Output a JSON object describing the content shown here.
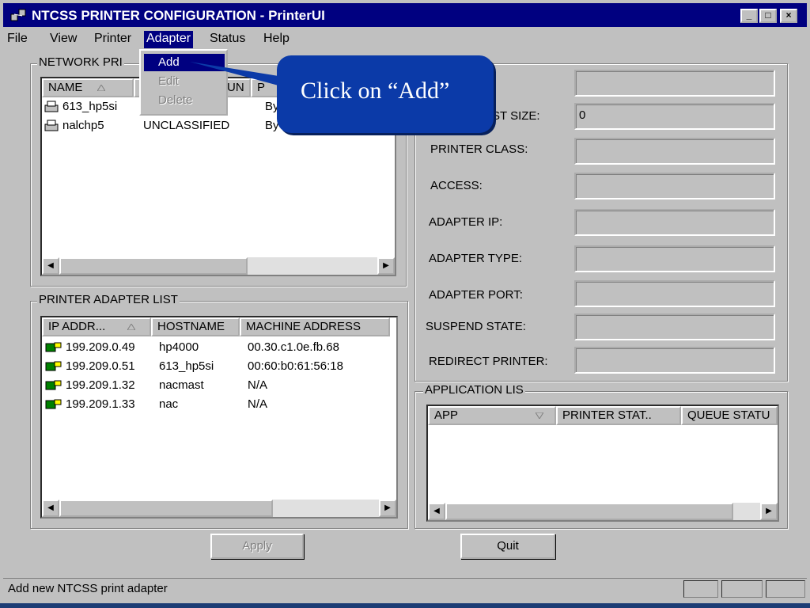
{
  "window": {
    "title": "NTCSS PRINTER CONFIGURATION - PrinterUI",
    "minimize": "_",
    "maximize": "□",
    "close": "×"
  },
  "menubar": [
    "File",
    "View",
    "Printer",
    "Adapter",
    "Status",
    "Help"
  ],
  "adapter_menu": {
    "items": [
      {
        "label": "Add",
        "state": "selected"
      },
      {
        "label": "Edit",
        "state": "disabled"
      },
      {
        "label": "Delete",
        "state": "disabled"
      }
    ]
  },
  "callout": {
    "text": "Click on “Add”"
  },
  "network_printers": {
    "label": "NETWORK PRI",
    "headers": [
      "NAME",
      "UN",
      "P"
    ],
    "rows": [
      {
        "name": "613_hp5si",
        "classification": "",
        "access": "By"
      },
      {
        "name": "nalchp5",
        "classification": "UNCLASSIFIED",
        "access": "By Application"
      }
    ],
    "header_sort_icon": "sort-up-triangle"
  },
  "adapter_list": {
    "label": "PRINTER ADAPTER LIST",
    "headers": [
      "IP ADDR...",
      "HOSTNAME",
      "MACHINE ADDRESS"
    ],
    "rows": [
      {
        "ip": "199.209.0.49",
        "host": "hp4000",
        "mac": "00.30.c1.0e.fb.68"
      },
      {
        "ip": "199.209.0.51",
        "host": "613_hp5si",
        "mac": "00:60:b0:61:56:18"
      },
      {
        "ip": "199.209.1.32",
        "host": "nacmast",
        "mac": "N/A"
      },
      {
        "ip": "199.209.1.33",
        "host": "nac",
        "mac": "N/A"
      }
    ]
  },
  "details": {
    "fields": [
      {
        "label": "",
        "value": ""
      },
      {
        "label": "EST SIZE:",
        "value": "0"
      },
      {
        "label": "PRINTER CLASS:",
        "value": ""
      },
      {
        "label": "ACCESS:",
        "value": ""
      },
      {
        "label": "ADAPTER IP:",
        "value": ""
      },
      {
        "label": "ADAPTER TYPE:",
        "value": ""
      },
      {
        "label": "ADAPTER PORT:",
        "value": ""
      },
      {
        "label": "SUSPEND STATE:",
        "value": ""
      },
      {
        "label": "REDIRECT PRINTER:",
        "value": ""
      }
    ]
  },
  "application_list": {
    "label": "APPLICATION LIS",
    "headers": [
      "APP",
      "PRINTER STAT..",
      "QUEUE STATU"
    ]
  },
  "buttons": {
    "apply": "Apply",
    "quit": "Quit"
  },
  "status_bar": {
    "text": "Add new NTCSS print adapter"
  }
}
